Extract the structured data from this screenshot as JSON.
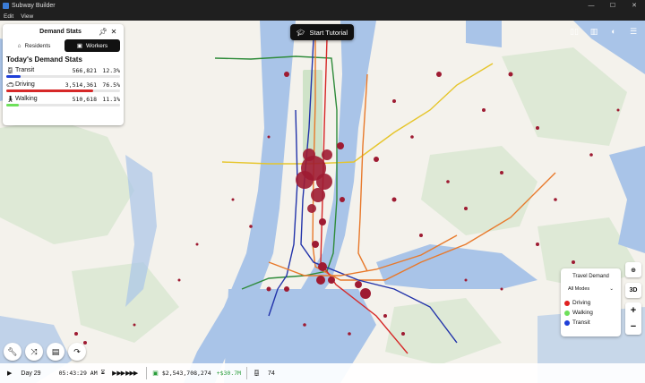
{
  "window": {
    "title": "Subway Builder",
    "controls": [
      "—",
      "☐",
      "✕"
    ]
  },
  "menu": [
    "Edit",
    "View"
  ],
  "demand_panel": {
    "title": "Demand Stats",
    "tabs": [
      {
        "label": "Residents",
        "active": false
      },
      {
        "label": "Workers",
        "active": true
      }
    ],
    "heading": "Today's Demand Stats",
    "rows": [
      {
        "label": "Transit",
        "value": "566,821",
        "pct": "12.3%",
        "fraction": 0.123,
        "color": "#1e3fd8"
      },
      {
        "label": "Driving",
        "value": "3,514,361",
        "pct": "76.5%",
        "fraction": 0.765,
        "color": "#d62828"
      },
      {
        "label": "Walking",
        "value": "510,618",
        "pct": "11.1%",
        "fraction": 0.111,
        "color": "#6ee05a"
      }
    ]
  },
  "tutorial": {
    "label": "Start Tutorial"
  },
  "legend": {
    "title": "Travel Demand",
    "select_value": "All Modes",
    "items": [
      {
        "label": "Driving",
        "color": "#e02020"
      },
      {
        "label": "Walking",
        "color": "#6ee05a"
      },
      {
        "label": "Transit",
        "color": "#1e3fd8"
      }
    ]
  },
  "controls": {
    "view_3d": "3D",
    "zoom_in": "+",
    "zoom_out": "−"
  },
  "status": {
    "day": "Day 29",
    "time": "05:43:29 AM",
    "money": "$2,543,708,274",
    "delta": "+$30.7M",
    "trains": "74"
  },
  "colors": {
    "water": "#a9c4e8",
    "park": "#cfe3c8",
    "land": "#f4f2ec",
    "demand": "#9e1b32",
    "line_orange": "#e8792b",
    "line_yellow": "#e6c52a",
    "line_green": "#2e8b3a",
    "line_blue": "#2233aa",
    "line_red": "#d62828"
  }
}
